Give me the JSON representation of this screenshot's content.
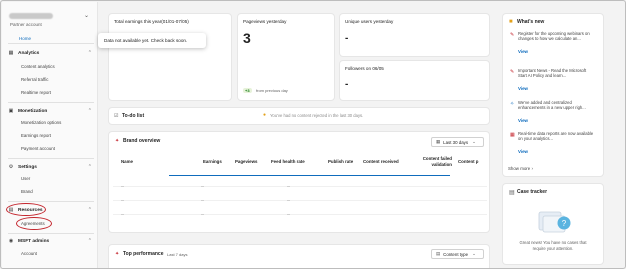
{
  "sidebar": {
    "partner_account": "Partner account",
    "home": "Home",
    "sections": [
      {
        "label": "Analytics",
        "items": [
          "Content analytics",
          "Referral traffic",
          "Realtime report"
        ]
      },
      {
        "label": "Monetization",
        "items": [
          "Monetization options",
          "Earnings report",
          "Payment account"
        ]
      },
      {
        "label": "Settings",
        "items": [
          "User",
          "Brand"
        ]
      },
      {
        "label": "Resources",
        "items": [
          "Agreements"
        ]
      },
      {
        "label": "MSFT admins",
        "items": [
          "Account"
        ]
      }
    ]
  },
  "stats": {
    "earnings_title": "Total earnings this year(01/01-07/05)",
    "tooltip": "Data not available yet. Check back soon.",
    "pageviews_title": "Pageviews yesterday",
    "pageviews_value": "3",
    "pageviews_badge": "+3",
    "pageviews_note": "from previous day",
    "unique_users_title": "Unique users yesterday",
    "unique_users_value": "-",
    "followers_title": "Followers on 06/05",
    "followers_value": "-"
  },
  "todo": {
    "title": "To-do list",
    "message": "You've had no content rejected in the last 30 days."
  },
  "brand_overview": {
    "title": "Brand overview",
    "range": "Last 30 days",
    "columns": [
      "Name",
      "Earnings",
      "Pageviews",
      "Feed health rate",
      "Publish rate",
      "Content received",
      "Content failed validation",
      "Content p"
    ]
  },
  "top_performance": {
    "title": "Top performance",
    "subtitle": "Last 7 days",
    "filter": "Content type"
  },
  "whats_new": {
    "title": "What's new",
    "items": [
      {
        "text": "Register for the upcoming webinars on changes to how we calculate an...",
        "link": "View"
      },
      {
        "text": "Important News - Read the Microsoft Start AI Policy and learn...",
        "link": "View"
      },
      {
        "text": "We've added and centralized enhancements in a new upper righ...",
        "link": "View"
      },
      {
        "text": "Real-time data reports are now available on your analytics...",
        "link": "View"
      }
    ],
    "show_more": "Show more"
  },
  "case_tracker": {
    "title": "Case tracker",
    "message_line1": "Great news! You have no cases that",
    "message_line2": "require your attention."
  },
  "colors": {
    "accent": "#0f6cbd",
    "annotation": "#c4262e",
    "positive": "#107c10"
  }
}
